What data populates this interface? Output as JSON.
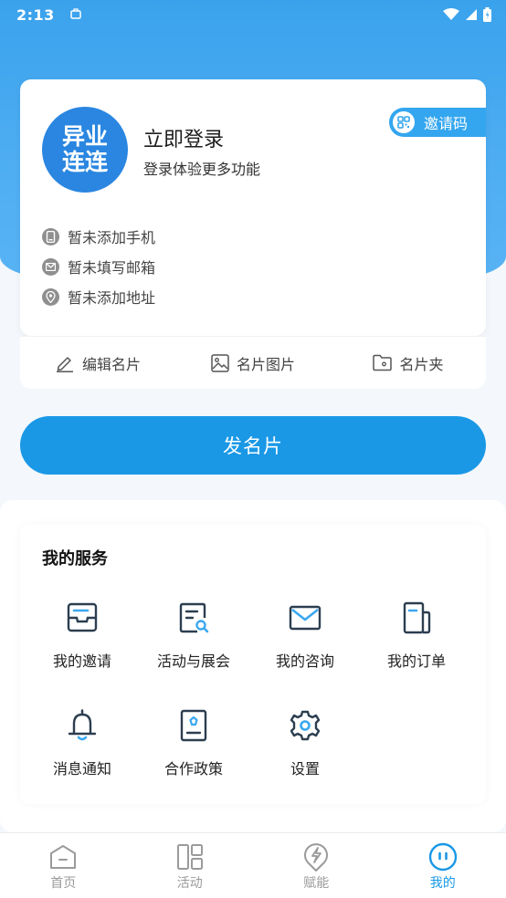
{
  "status_bar": {
    "time": "2:13"
  },
  "profile": {
    "avatar_line1": "异业",
    "avatar_line2": "连连",
    "login_title": "立即登录",
    "login_subtitle": "登录体验更多功能",
    "invite_label": "邀请码",
    "phone": "暂未添加手机",
    "email": "暂未填写邮箱",
    "address": "暂未添加地址"
  },
  "card_actions": {
    "edit": "编辑名片",
    "image": "名片图片",
    "folder": "名片夹"
  },
  "send_button": "发名片",
  "services": {
    "title": "我的服务",
    "items": [
      {
        "label": "我的邀请",
        "icon": "invite-tray-icon"
      },
      {
        "label": "活动与展会",
        "icon": "activity-search-icon"
      },
      {
        "label": "我的咨询",
        "icon": "mail-icon"
      },
      {
        "label": "我的订单",
        "icon": "order-icon"
      },
      {
        "label": "消息通知",
        "icon": "bell-icon"
      },
      {
        "label": "合作政策",
        "icon": "policy-book-icon"
      },
      {
        "label": "设置",
        "icon": "gear-icon"
      }
    ]
  },
  "tabbar": {
    "items": [
      {
        "label": "首页",
        "icon": "home-icon"
      },
      {
        "label": "活动",
        "icon": "layout-icon"
      },
      {
        "label": "赋能",
        "icon": "lightning-icon"
      },
      {
        "label": "我的",
        "icon": "me-icon",
        "active": true
      }
    ]
  },
  "colors": {
    "primary": "#1a98e6",
    "accent_light": "#34a6ef",
    "header_gradient_top": "#3aa2ec",
    "icon_dark": "#2c3e50"
  }
}
